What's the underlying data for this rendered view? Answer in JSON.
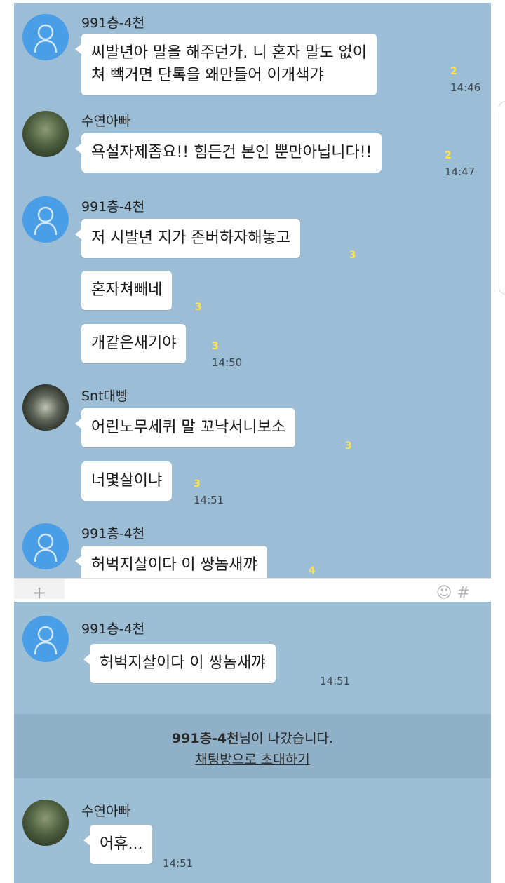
{
  "top_panel": {
    "groups": [
      {
        "sender": "991층-4천",
        "avatar": "default-person-icon",
        "messages": [
          {
            "text": "씨발년아 말을 해주던가. 니 혼자 말도 없이\n쳐 빽거면 단톡을 왜만들어 이개색갸",
            "unread": "2",
            "time": "14:46"
          }
        ]
      },
      {
        "sender": "수연아빠",
        "avatar": "photo",
        "messages": [
          {
            "text": "욕설자제좀요!!  힘든건 본인 뿐만아닙니다!!",
            "unread": "2",
            "time": "14:47"
          }
        ]
      },
      {
        "sender": "991층-4천",
        "avatar": "default-person-icon",
        "messages": [
          {
            "text": "저 시발년 지가 존버하자해놓고",
            "unread": "3",
            "time": ""
          },
          {
            "text": "혼자쳐빼네",
            "unread": "3",
            "time": ""
          },
          {
            "text": "개같은새기야",
            "unread": "3",
            "time": "14:50"
          }
        ]
      },
      {
        "sender": "Snt대빵",
        "avatar": "photo",
        "messages": [
          {
            "text": "어린노무세퀴 말 꼬낙서니보소",
            "unread": "3",
            "time": ""
          },
          {
            "text": "너몇살이냐",
            "unread": "3",
            "time": "14:51"
          }
        ]
      },
      {
        "sender": "991층-4천",
        "avatar": "default-person-icon",
        "messages": [
          {
            "text": "허벅지살이다 이 쌍놈새꺄",
            "unread": "4",
            "time": ""
          }
        ]
      }
    ],
    "input_bar": {
      "plus": "+",
      "icons": "☺ #"
    }
  },
  "bottom_panel": {
    "first": {
      "sender": "991층-4천",
      "text": "허벅지살이다 이 쌍놈새꺄",
      "time": "14:51"
    },
    "system": {
      "left_name": "991층-4천",
      "left_suffix": "님이 나갔습니다.",
      "invite": "채팅방으로 초대하기"
    },
    "last": {
      "sender": "수연아빠",
      "text": "어휴...",
      "time": "14:51"
    }
  },
  "colors": {
    "chat_bg": "#9cbdd6",
    "unread": "#ffe34c",
    "avatar_default": "#4a9ee6"
  }
}
